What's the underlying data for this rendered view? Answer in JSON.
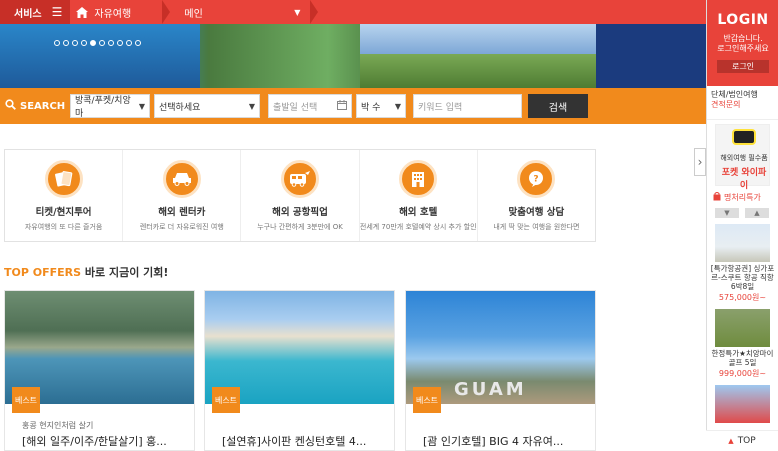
{
  "topnav": {
    "service_label": "서비스",
    "breadcrumb_1": "자유여행",
    "breadcrumb_2": "메인"
  },
  "banner": {
    "slide_count": 10,
    "active_slide": 5
  },
  "search": {
    "label": "SEARCH",
    "region_value": "방콕/푸켓/치앙마",
    "select_value": "선택하세요",
    "date_placeholder": "출발일 선택",
    "nights_value": "박 수",
    "keyword_placeholder": "키워드 입력",
    "button_label": "검색"
  },
  "services": [
    {
      "icon": "ticket-icon",
      "title": "티켓/현지투어",
      "desc": "자유여행의 또 다른 즐거움"
    },
    {
      "icon": "car-icon",
      "title": "해외 렌터카",
      "desc": "렌터카로 더 자유로워진 여행"
    },
    {
      "icon": "bus-icon",
      "title": "해외 공항픽업",
      "desc": "누구나 간편하게 3분만에 OK"
    },
    {
      "icon": "hotel-icon",
      "title": "해외 호텔",
      "desc": "전세계 70만개 호텔예약 상시 추가 할인"
    },
    {
      "icon": "question-icon",
      "title": "맞춤여행 상담",
      "desc": "내게 딱 맞는 여행을 원한다면"
    }
  ],
  "offers": {
    "title_highlight": "TOP OFFERS",
    "title_rest": "바로 지금이 기회!",
    "cards": [
      {
        "badge": "베스트",
        "subtitle": "홍콩 현지인처럼 살기",
        "title": "[해외 일주/이주/한달살기] 홍..."
      },
      {
        "badge": "베스트",
        "subtitle": "",
        "title": "[설연휴]사이판 켄싱턴호텔 4..."
      },
      {
        "badge": "베스트",
        "subtitle": "",
        "title": "[괌 인기호텔] BIG 4 자유여..."
      }
    ],
    "guam_sign": "GUAM"
  },
  "sidebar": {
    "login_title": "LOGIN",
    "login_msg_1": "반갑습니다.",
    "login_msg_2": "로그인해주세요",
    "login_button": "로그인",
    "group_text": "단체/법인여행",
    "group_link": "견적문의",
    "wifi_line1": "해외여행 필수품",
    "wifi_line2": "포켓 와이파이",
    "md_title": "명처리특가",
    "items": [
      {
        "text": "[특가항공권] 싱가포르-스쿠트 항공 직항 6박8일",
        "price": "575,000원~"
      },
      {
        "text": "한정특가★치앙마이 골프 5일",
        "price": "999,000원~"
      }
    ],
    "top_label": "TOP"
  },
  "colors": {
    "primary_red": "#e8433a",
    "accent_orange": "#f18a1c"
  }
}
